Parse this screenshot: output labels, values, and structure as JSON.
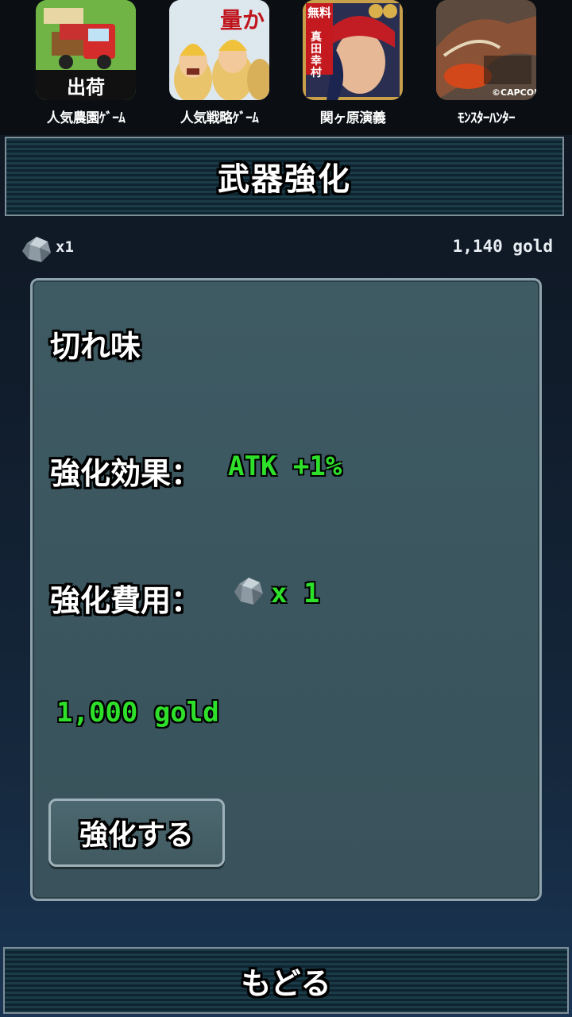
{
  "ads": [
    {
      "name": "farm-game-ad",
      "caption": "人気農園ｹﾞｰﾑ",
      "badge": "出荷"
    },
    {
      "name": "strategy-game-ad",
      "caption": "人気戦略ｹﾞｰﾑ",
      "badge": "量か"
    },
    {
      "name": "sekigahara-ad",
      "caption": "関ヶ原演義",
      "badge": "無料",
      "badge2": "真田幸村"
    },
    {
      "name": "monster-hunter-ad",
      "caption": "ﾓﾝｽﾀｰﾊﾝﾀｰ",
      "badge": "©CAPCOM"
    }
  ],
  "header": {
    "title": "武器強化"
  },
  "status": {
    "ore_icon": "ore-icon",
    "ore_count": "x1",
    "gold_total": "1,140 gold"
  },
  "panel": {
    "item_name": "切れ味",
    "effect_label": "強化効果：",
    "effect_value": "ATK +1%",
    "cost_label": "強化費用：",
    "cost_ore_qty": "x 1",
    "cost_gold": "1,000 gold",
    "enhance_button": "強化する"
  },
  "footer": {
    "back_button": "もどる"
  },
  "colors": {
    "accent_green": "#2ee02a",
    "panel_bg": "#3e5a63",
    "banner_stripe": "#1b3b48"
  }
}
